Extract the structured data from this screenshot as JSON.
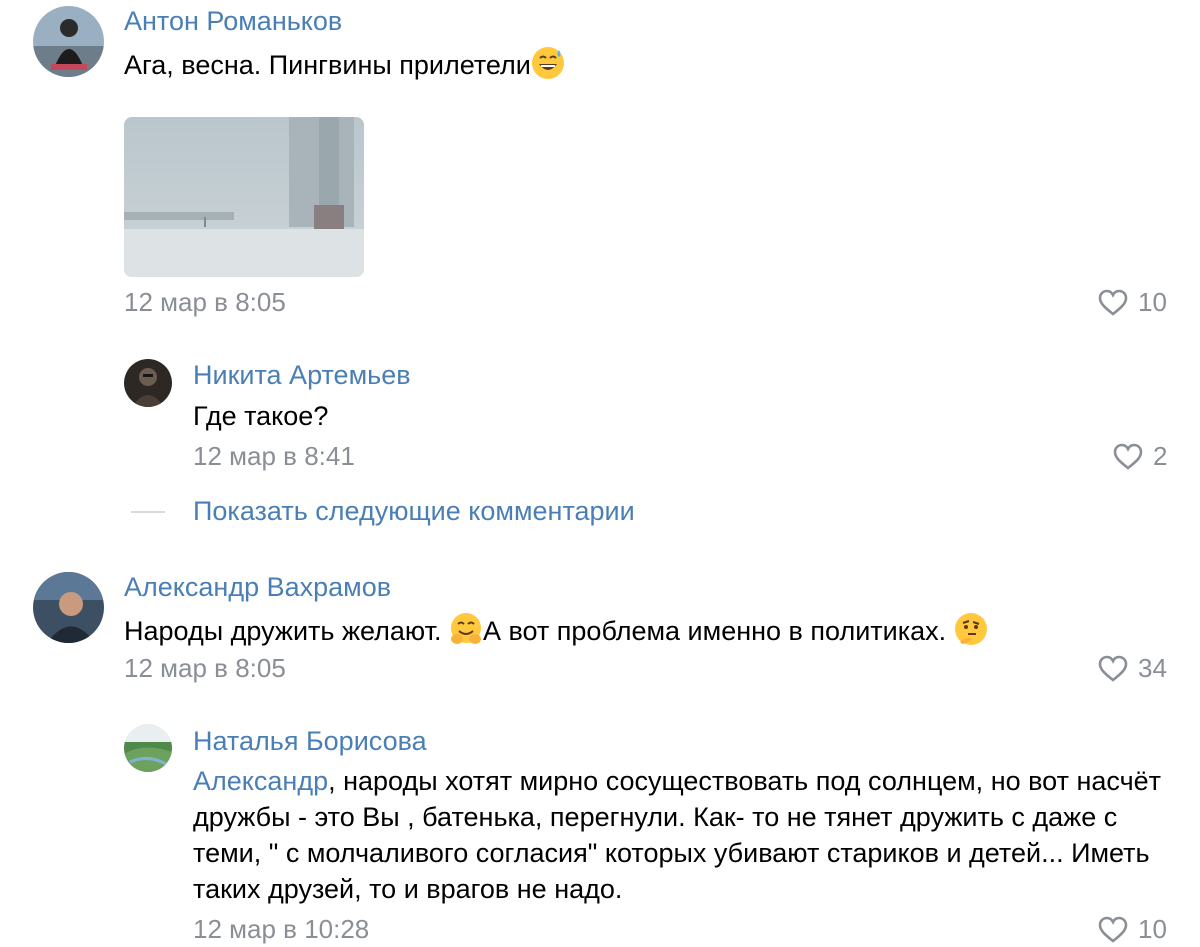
{
  "comments": [
    {
      "author": "Антон Романьков",
      "text": "Ага, весна. Пингвины прилетели",
      "emoji": "grinning-sweat-emoji",
      "time": "12 мар в 8:05",
      "likes": "10"
    },
    {
      "author": "Никита Артемьев",
      "text": "Где такое?",
      "time": "12 мар в 8:41",
      "likes": "2"
    },
    {
      "author": "Александр Вахрамов",
      "text_part1": "Народы дружить желают. ",
      "emoji1": "hugging-face-emoji",
      "text_part2": "А вот проблема именно в политиках. ",
      "emoji2": "thinking-face-emoji",
      "time": "12 мар в 8:05",
      "likes": "34"
    },
    {
      "author": "Наталья Борисова",
      "mention": "Александр",
      "text": ", народы хотят мирно сосуществовать под солнцем, но вот насчёт дружбы - это Вы , батенька, перегнули. Как- то не тянет дружить с даже с теми, \" с молчаливого согласия\" которых убивают стариков и детей... Иметь таких друзей, то и врагов не надо.",
      "time": "12 мар в 10:28",
      "likes": "10"
    }
  ],
  "show_more_label": "Показать следующие комментарии",
  "colors": {
    "link": "#4a7fb5",
    "meta": "#8a8f96",
    "text": "#000000"
  }
}
